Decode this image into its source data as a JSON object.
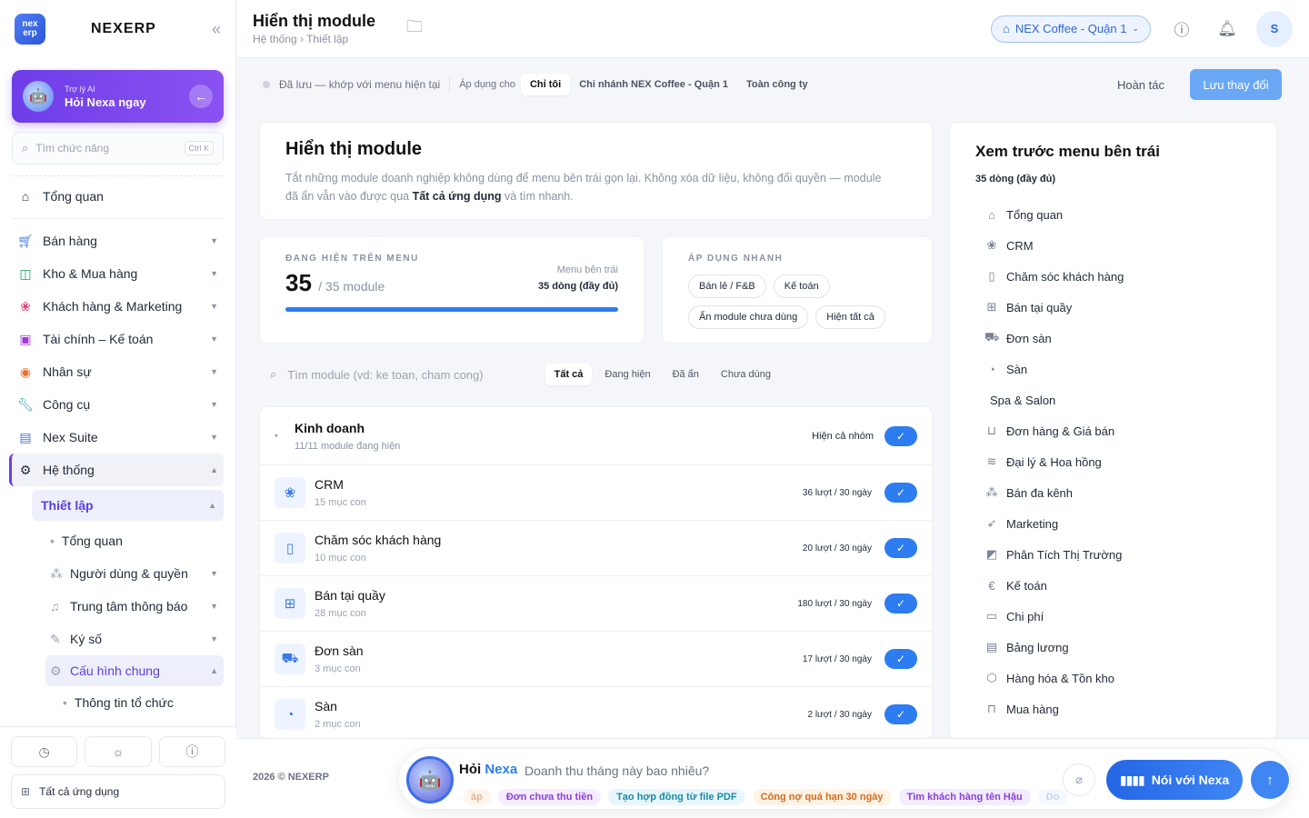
{
  "brand": {
    "logo_text": "nex erp",
    "name": "NEXERP"
  },
  "ai_card": {
    "sub": "Trợ lý AI",
    "main": "Hỏi Nexa ngay"
  },
  "search": {
    "placeholder": "Tìm chức năng",
    "shortcut": "Ctrl K"
  },
  "nav": {
    "overview": "Tổng quan",
    "sales": "Bán hàng",
    "warehouse": "Kho & Mua hàng",
    "customers": "Khách hàng & Marketing",
    "finance": "Tài chính – Kế toán",
    "hr": "Nhân sự",
    "tools": "Công cụ",
    "suite": "Nex Suite",
    "system": "Hệ thống",
    "setup": "Thiết lập",
    "sub_overview": "Tổng quan",
    "users": "Người dùng & quyền",
    "notifications": "Trung tâm thông báo",
    "signing": "Ký số",
    "general": "Cấu hình chung",
    "org_info": "Thông tin tổ chức"
  },
  "sidebar_bottom": {
    "all_apps": "Tất cả ứng dụng"
  },
  "header": {
    "title": "Hiển thị module",
    "breadcrumb": "Hệ thống › Thiết lập",
    "branch": "NEX Coffee - Quận 1",
    "avatar": "S"
  },
  "toolbar": {
    "status": "Đã lưu — khớp với menu hiện tại",
    "apply_for": "Áp dụng cho",
    "scopes": [
      "Chỉ tôi",
      "Chi nhánh NEX Coffee - Quận 1",
      "Toàn công ty"
    ],
    "undo": "Hoàn tác",
    "save": "Lưu thay đổi"
  },
  "intro": {
    "title": "Hiển thị module",
    "desc_1": "Tắt những module doanh nghiệp không dùng để menu bên trái gọn lại. Không xóa dữ liệu, không đổi quyền — module đã ẩn vẫn vào được qua ",
    "desc_bold": "Tất cả ứng dụng",
    "desc_2": " và tìm nhanh."
  },
  "shown": {
    "label": "ĐANG HIỆN TRÊN MENU",
    "count": "35",
    "total": "/ 35 module",
    "meta_label": "Menu bên trái",
    "meta_value": "35 dòng (đầy đủ)",
    "progress": 1.0
  },
  "quick": {
    "label": "ÁP DỤNG NHANH",
    "chips": [
      "Bán lẻ / F&B",
      "Kế toán",
      "Ẩn module chưa dùng",
      "Hiện tất cả"
    ]
  },
  "filter": {
    "placeholder": "Tìm module (vd: ke toan, cham cong)",
    "tabs": [
      "Tất cả",
      "Đang hiện",
      "Đã ẩn",
      "Chưa dùng"
    ]
  },
  "group": {
    "name": "Kinh doanh",
    "sub": "11/11 module đang hiện",
    "toggle_label": "Hiện cả nhóm"
  },
  "modules": [
    {
      "name": "CRM",
      "sub": "15 mục con",
      "usage": "36 lượt / 30 ngày"
    },
    {
      "name": "Chăm sóc khách hàng",
      "sub": "10 mục con",
      "usage": "20 lượt / 30 ngày"
    },
    {
      "name": "Bán tại quầy",
      "sub": "28 mục con",
      "usage": "180 lượt / 30 ngày"
    },
    {
      "name": "Đơn sàn",
      "sub": "3 mục con",
      "usage": "17 lượt / 30 ngày"
    },
    {
      "name": "Sàn",
      "sub": "2 mục con",
      "usage": "2 lượt / 30 ngày"
    }
  ],
  "preview": {
    "title": "Xem trước menu bên trái",
    "count": "35 dòng (đầy đủ)",
    "items": [
      "Tổng quan",
      "CRM",
      "Chăm sóc khách hàng",
      "Bán tại quầy",
      "Đơn sàn",
      "Sàn",
      "Spa & Salon",
      "Đơn hàng & Giá bán",
      "Đại lý & Hoa hồng",
      "Bán đa kênh",
      "Marketing",
      "Phân Tích Thị Trường",
      "Kế toán",
      "Chi phí",
      "Bảng lương",
      "Hàng hóa & Tồn kho",
      "Mua hàng"
    ]
  },
  "footer": {
    "copyright": "2026 © NEXERP",
    "ask_prefix": "Hỏi",
    "ask_name": "Nexa",
    "question": "Doanh thu tháng này bao nhiêu?",
    "suggestions": [
      "áp",
      "Đơn chưa thu tiền",
      "Tạo hợp đồng từ file PDF",
      "Công nợ quá hạn 30 ngày",
      "Tìm khách hàng tên Hậu",
      "Do"
    ],
    "speak": "Nói với Nexa"
  }
}
